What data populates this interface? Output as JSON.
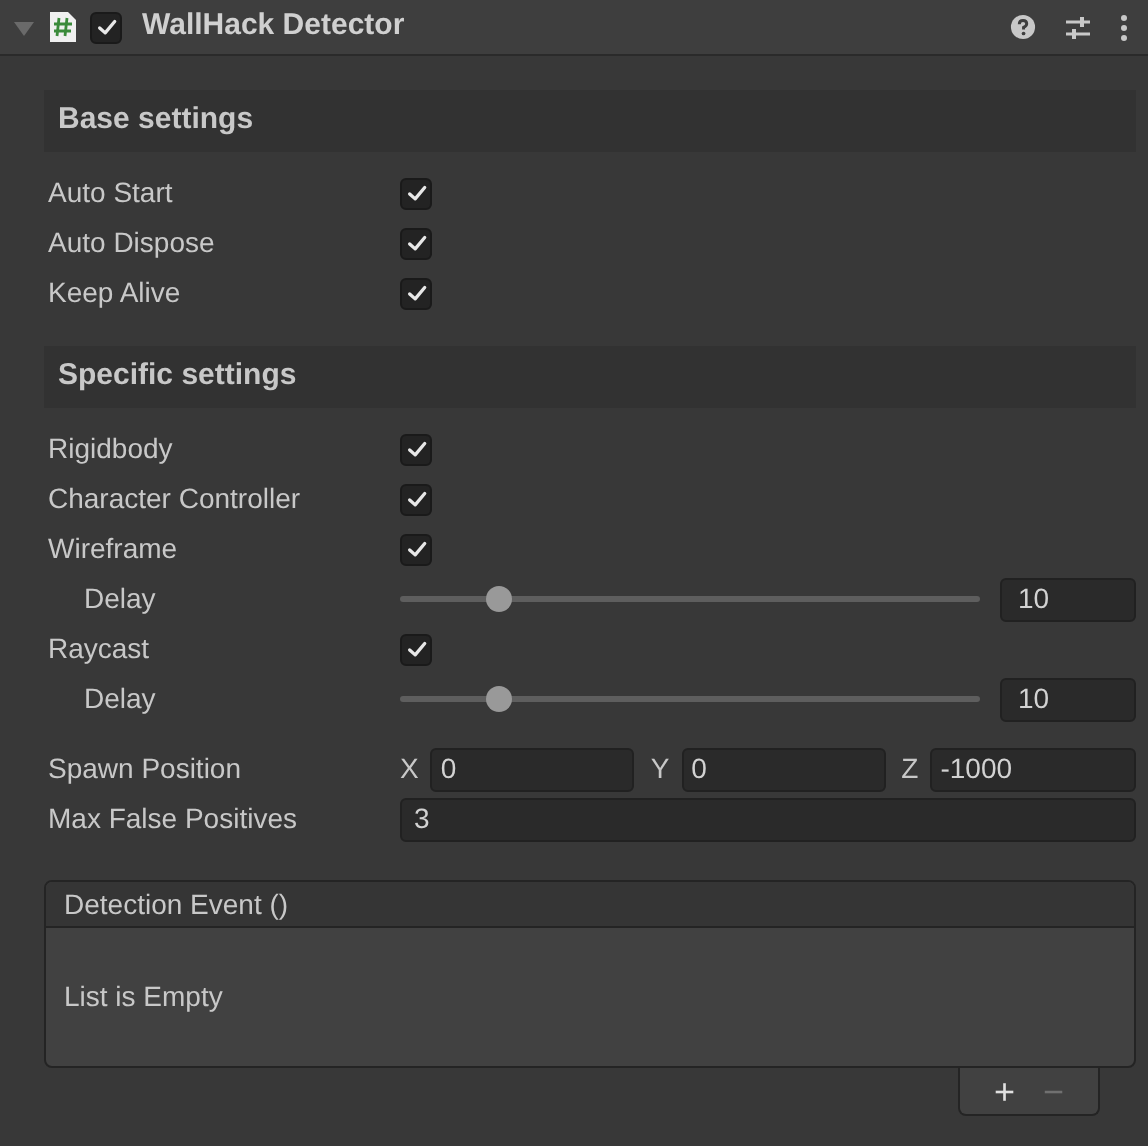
{
  "header": {
    "expanded": true,
    "enabled": true,
    "title": "WallHack Detector"
  },
  "sections": [
    {
      "title": "Base settings",
      "rows": [
        {
          "kind": "checkbox",
          "label": "Auto Start",
          "checked": true
        },
        {
          "kind": "checkbox",
          "label": "Auto Dispose",
          "checked": true
        },
        {
          "kind": "checkbox",
          "label": "Keep Alive",
          "checked": true
        }
      ]
    },
    {
      "title": "Specific settings",
      "rows": [
        {
          "kind": "checkbox",
          "label": "Rigidbody",
          "checked": true
        },
        {
          "kind": "checkbox",
          "label": "Character Controller",
          "checked": true
        },
        {
          "kind": "checkbox",
          "label": "Wireframe",
          "checked": true,
          "children": [
            {
              "kind": "slider",
              "label": "Delay",
              "level": 0.17,
              "value": "10"
            }
          ]
        },
        {
          "kind": "checkbox",
          "label": "Raycast",
          "checked": true,
          "children": [
            {
              "kind": "slider",
              "label": "Delay",
              "level": 0.17,
              "value": "10"
            }
          ]
        }
      ]
    }
  ],
  "fields": [
    {
      "kind": "vector3",
      "label": "Spawn Position",
      "axes": [
        {
          "axis": "X",
          "value": "0"
        },
        {
          "axis": "Y",
          "value": "0"
        },
        {
          "axis": "Z",
          "value": "-1000"
        }
      ]
    },
    {
      "kind": "number",
      "label": "Max False Positives",
      "value": "3"
    }
  ],
  "event_list": {
    "title": "Detection Event ()",
    "empty_text": "List is Empty",
    "buttons": [
      {
        "label": "+",
        "disabled": false
      },
      {
        "label": "−",
        "disabled": true
      }
    ]
  }
}
